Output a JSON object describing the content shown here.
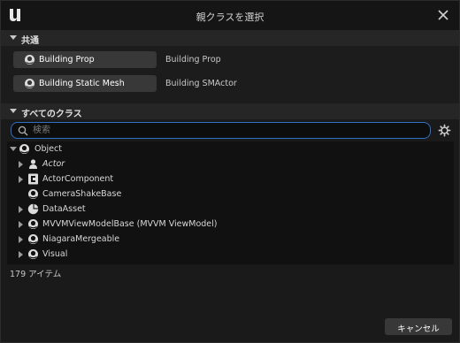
{
  "window": {
    "title": "親クラスを選択"
  },
  "common": {
    "header": "共通",
    "items": [
      {
        "button_label": "Building Prop",
        "description": "Building Prop"
      },
      {
        "button_label": "Building Static Mesh",
        "description": "Building SMActor"
      }
    ]
  },
  "all_classes": {
    "header": "すべてのクラス",
    "search": {
      "placeholder": "検索",
      "value": ""
    },
    "tree": [
      {
        "label": "Object",
        "expanded": true,
        "icon": "class-sphere-icon"
      },
      {
        "label": "Actor",
        "expanded": false,
        "icon": "actor-icon",
        "italic": true
      },
      {
        "label": "ActorComponent",
        "expanded": false,
        "icon": "component-icon"
      },
      {
        "label": "CameraShakeBase",
        "expanded": false,
        "icon": "class-sphere-icon"
      },
      {
        "label": "DataAsset",
        "expanded": false,
        "icon": "data-asset-icon"
      },
      {
        "label": "MVVMViewModelBase (MVVM ViewModel)",
        "expanded": false,
        "icon": "class-sphere-icon"
      },
      {
        "label": "NiagaraMergeable",
        "expanded": false,
        "icon": "class-sphere-icon"
      },
      {
        "label": "Visual",
        "expanded": false,
        "icon": "class-sphere-icon"
      }
    ],
    "item_count": "179 アイテム"
  },
  "footer": {
    "cancel_label": "キャンセル"
  },
  "colors": {
    "accent": "#2f6fc8",
    "background": "#1a1a1a",
    "button": "#383838"
  }
}
